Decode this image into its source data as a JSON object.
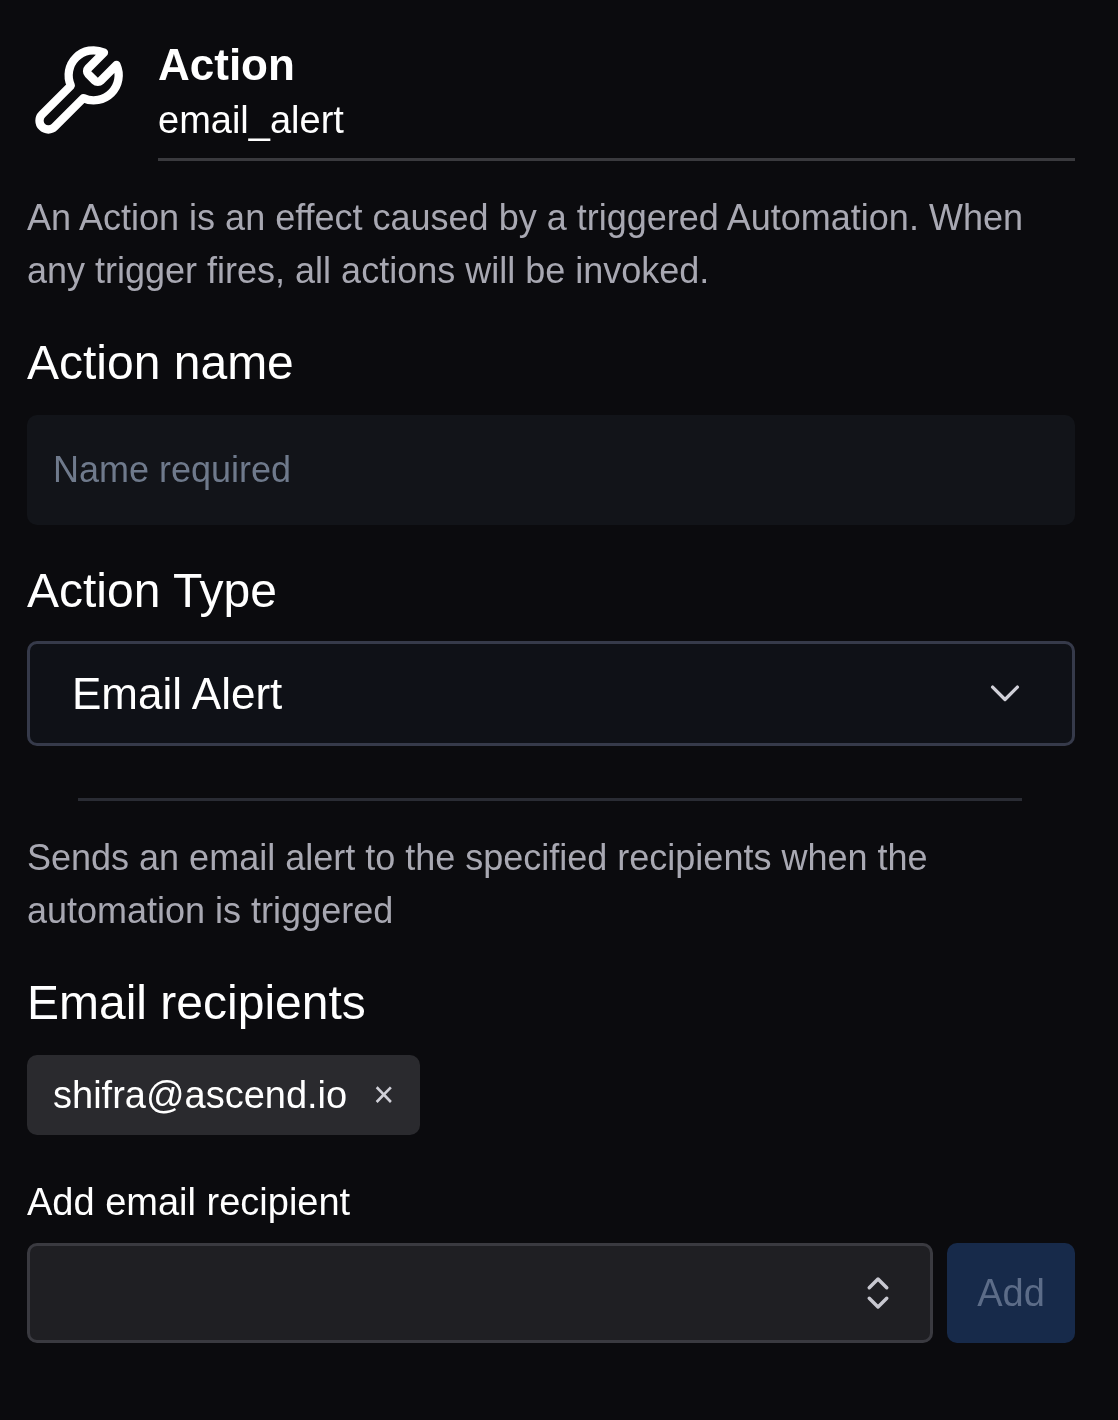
{
  "header": {
    "title": "Action",
    "subtitle": "email_alert"
  },
  "description": "An Action is an effect caused by a triggered Automation. When any trigger fires, all actions will be invoked.",
  "name_field": {
    "label": "Action name",
    "placeholder": "Name required"
  },
  "type_field": {
    "label": "Action Type",
    "value": "Email Alert"
  },
  "type_description": "Sends an email alert to the specified recipients when the automation is triggered",
  "recipients": {
    "label": "Email recipients",
    "items": [
      {
        "email": "shifra@ascend.io",
        "remove": "×"
      }
    ]
  },
  "add_field": {
    "label": "Add email recipient"
  },
  "add_button": {
    "label": "Add",
    "disabled": true
  }
}
